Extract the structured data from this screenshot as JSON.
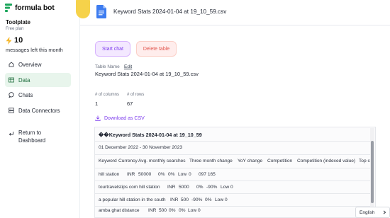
{
  "brand": {
    "name": "formula bot"
  },
  "workspace": {
    "name": "Toolplate",
    "plan": "Free plan",
    "credits": "10",
    "credits_label": "messages left this month"
  },
  "nav": {
    "overview": "Overview",
    "data": "Data",
    "chats": "Chats",
    "connectors": "Data Connectors",
    "return": "Return to Dashboard"
  },
  "file": {
    "title": "Keyword Stats 2024-01-04 at 19_10_59.csv"
  },
  "actions": {
    "start_chat": "Start chat",
    "delete_table": "Delete table"
  },
  "table_meta": {
    "name_label": "Table Name",
    "edit": "Edit",
    "name": "Keyword Stats 2024-01-04 at 19_10_59.csv",
    "columns_label": "# of columns",
    "columns": "1",
    "rows_label": "# of rows",
    "rows": "67",
    "download": "Download as CSV"
  },
  "preview": {
    "title": "��Keyword Stats 2024-01-04 at 19_10_59",
    "date_range": "01 December 2022 - 30 November 2023",
    "headers": [
      "Keyword",
      "Currency",
      "Avg. monthly searches",
      "Three month change",
      "YoY change",
      "Competition",
      "Competition (indexed value)",
      "Top c"
    ],
    "rows": [
      [
        "hill station",
        "INR",
        "50000",
        "0%",
        "0%",
        "Low",
        "0",
        "097 165"
      ],
      [
        "tourtravelstips com hill station",
        "INR",
        "5000",
        "0%",
        "-90%",
        "Low",
        "0"
      ],
      [
        "a popular hill station in the south",
        "INR",
        "500",
        "-90%",
        "0%",
        "Low",
        "0"
      ],
      [
        "amba ghat distance",
        "INR",
        "500",
        "0%",
        "0%",
        "Low",
        "0"
      ]
    ]
  },
  "language": "English"
}
